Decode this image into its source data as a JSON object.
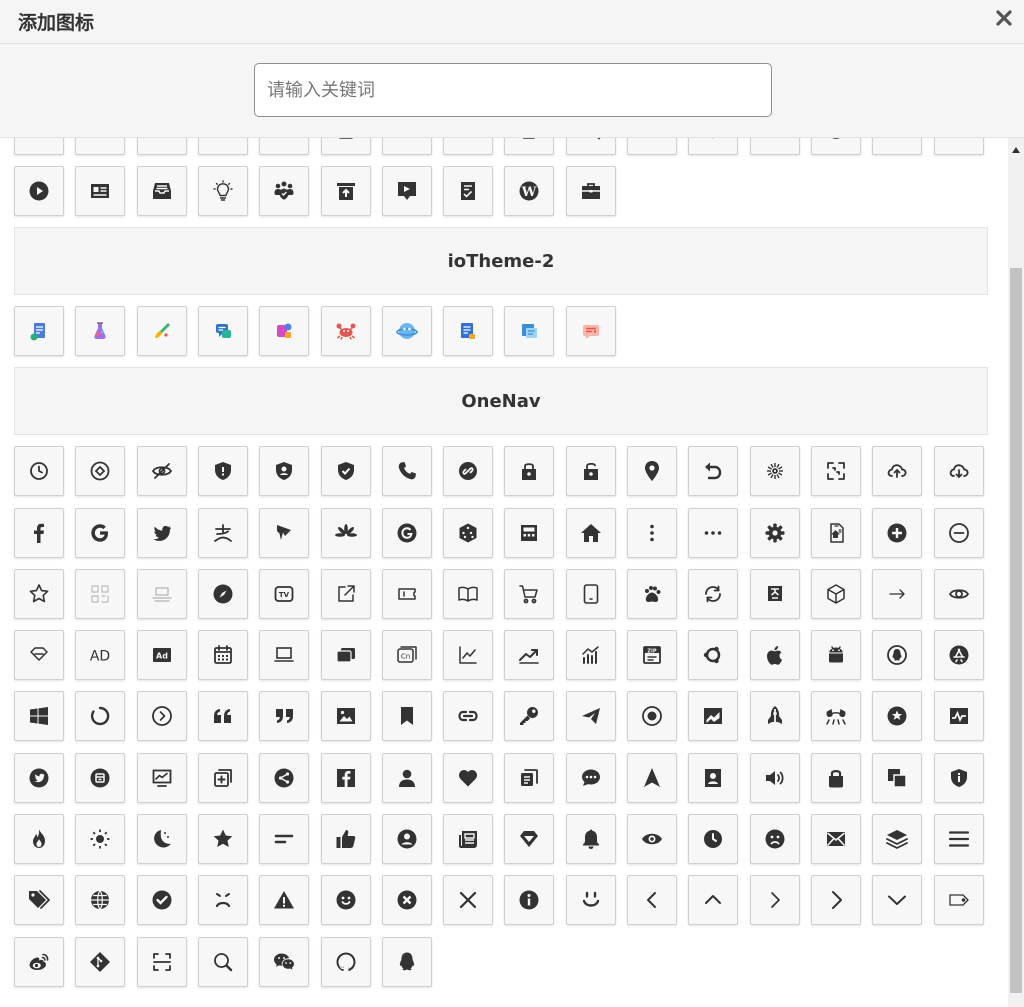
{
  "dialog": {
    "title": "添加图标",
    "close_icon": "close-icon"
  },
  "search": {
    "placeholder": "请输入关键词",
    "value": ""
  },
  "groups": [
    {
      "id": "previous-group",
      "title": "",
      "icons": [
        "dots-icon",
        "layout-icon",
        "note-icon",
        "pin-icon",
        "pin-icon",
        "doc-icon",
        "card-icon",
        "box-icon",
        "file-icon",
        "search-icon",
        "box-icon",
        "heart-icon",
        "glasses-icon",
        "clock-icon",
        "box-icon",
        "glasses-icon",
        "play-circle-icon",
        "id-card-icon",
        "inbox-icon",
        "lightbulb-icon",
        "team-shield-icon",
        "upload-box-icon",
        "flag-screen-icon",
        "task-icon",
        "wordpress-icon",
        "briefcase-icon"
      ]
    },
    {
      "id": "iotheme-2",
      "title": "ioTheme-2",
      "icons": [
        "color-document-icon",
        "color-flask-icon",
        "color-brush-icon",
        "color-chat-icon",
        "color-shapes-icon",
        "color-crab-icon",
        "color-planet-icon",
        "color-list-icon",
        "color-form-icon",
        "color-message-icon"
      ]
    },
    {
      "id": "onenav",
      "title": "OneNav",
      "icons": [
        "clock-icon",
        "target-icon",
        "eye-off-icon",
        "shield-icon",
        "user-shield-icon",
        "shield-check-icon",
        "phone-icon",
        "link-circle-icon",
        "lock-icon",
        "unlock-icon",
        "location-icon",
        "undo-icon",
        "loading-sun-icon",
        "scan-icon",
        "cloud-upload-icon",
        "cloud-download-icon",
        "facebook-icon",
        "google-icon",
        "twitter-icon",
        "alipay-icon",
        "paper-plane-icon",
        "huawei-icon",
        "grammarly-icon",
        "dice-icon",
        "calculator-icon",
        "home-icon",
        "more-vertical-icon",
        "more-horizontal-icon",
        "gear-icon",
        "file-upload-icon",
        "plus-circle-icon",
        "minus-circle-icon",
        "star-outline-icon",
        "qr-icon",
        "scanner-icon",
        "compass-icon",
        "tv-icon",
        "external-link-icon",
        "ticket-icon",
        "book-open-icon",
        "cart-icon",
        "tablet-icon",
        "baidu-icon",
        "refresh-icon",
        "translate-icon",
        "cube-icon",
        "arrow-right-icon",
        "eye-icon",
        "diamond-icon",
        "ad-outline-icon",
        "ad-solid-icon",
        "calendar-icon",
        "laptop-icon",
        "window-stack-icon",
        "cn-icon",
        "chart-line-icon",
        "trend-icon",
        "bar-chart-icon",
        "zip-icon",
        "ubuntu-icon",
        "apple-icon",
        "android-icon",
        "qq-circle-icon",
        "app-store-icon",
        "windows-icon",
        "spinner-icon",
        "chevron-right-circle-icon",
        "quote-left-icon",
        "quote-right-icon",
        "image-icon",
        "bookmark-icon",
        "link-icon",
        "key-icon",
        "send-icon",
        "record-icon",
        "photo-chart-icon",
        "rocket-icon",
        "goggles-icon",
        "star-badge-icon",
        "pulse-icon",
        "twitter-circle-icon",
        "toolbox-icon",
        "monitor-chart-icon",
        "copy-plus-icon",
        "share-icon",
        "facebook-square-icon",
        "user-icon",
        "heart-icon",
        "copy-icon",
        "comment-dots-icon",
        "navigation-icon",
        "contact-card-icon",
        "volume-icon",
        "lock-solid-icon",
        "clone-icon",
        "info-shield-icon",
        "fire-icon",
        "sun-icon",
        "moon-icon",
        "star-icon",
        "align-left-icon",
        "thumbs-up-icon",
        "user-circle-icon",
        "newspaper-icon",
        "gem-icon",
        "bell-icon",
        "eye-solid-icon",
        "clock-solid-icon",
        "frown-icon",
        "envelope-icon",
        "layers-icon",
        "menu-icon",
        "tags-icon",
        "globe-icon",
        "check-circle-icon",
        "sad-face-icon",
        "warning-icon",
        "smile-icon",
        "x-circle-icon",
        "close-x-icon",
        "info-circle-icon",
        "smile-line-icon",
        "chevron-left-icon",
        "chevron-up-icon",
        "chevron-right-icon",
        "chevron-right-bold-icon",
        "chevron-down-icon",
        "tag-icon",
        "weibo-icon",
        "git-icon",
        "scan-line-icon",
        "search-icon",
        "wechat-icon",
        "github-icon",
        "qq-icon"
      ]
    }
  ],
  "colors": {
    "icon": "#333333",
    "header_bg": "#f5f5f5",
    "cell_bg": "#f7f7f7",
    "cell_border": "#d0d0d0"
  }
}
